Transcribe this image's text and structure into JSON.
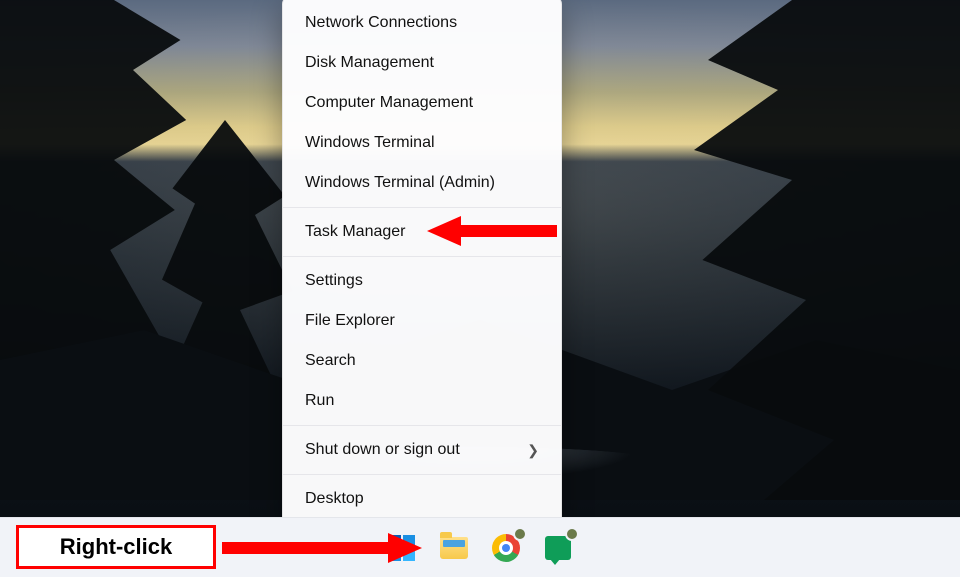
{
  "context_menu": {
    "group1": [
      {
        "label": "Network Connections"
      },
      {
        "label": "Disk Management"
      },
      {
        "label": "Computer Management"
      },
      {
        "label": "Windows Terminal"
      },
      {
        "label": "Windows Terminal (Admin)"
      }
    ],
    "group2": [
      {
        "label": "Task Manager"
      }
    ],
    "group3": [
      {
        "label": "Settings"
      },
      {
        "label": "File Explorer"
      },
      {
        "label": "Search"
      },
      {
        "label": "Run"
      }
    ],
    "group4": [
      {
        "label": "Shut down or sign out",
        "submenu": true
      }
    ],
    "group5": [
      {
        "label": "Desktop"
      }
    ]
  },
  "taskbar": {
    "icons": {
      "start": "Start",
      "file_explorer": "File Explorer",
      "chrome": "Google Chrome",
      "google_chat": "Google Chat"
    }
  },
  "annotations": {
    "right_click_label": "Right-click"
  }
}
